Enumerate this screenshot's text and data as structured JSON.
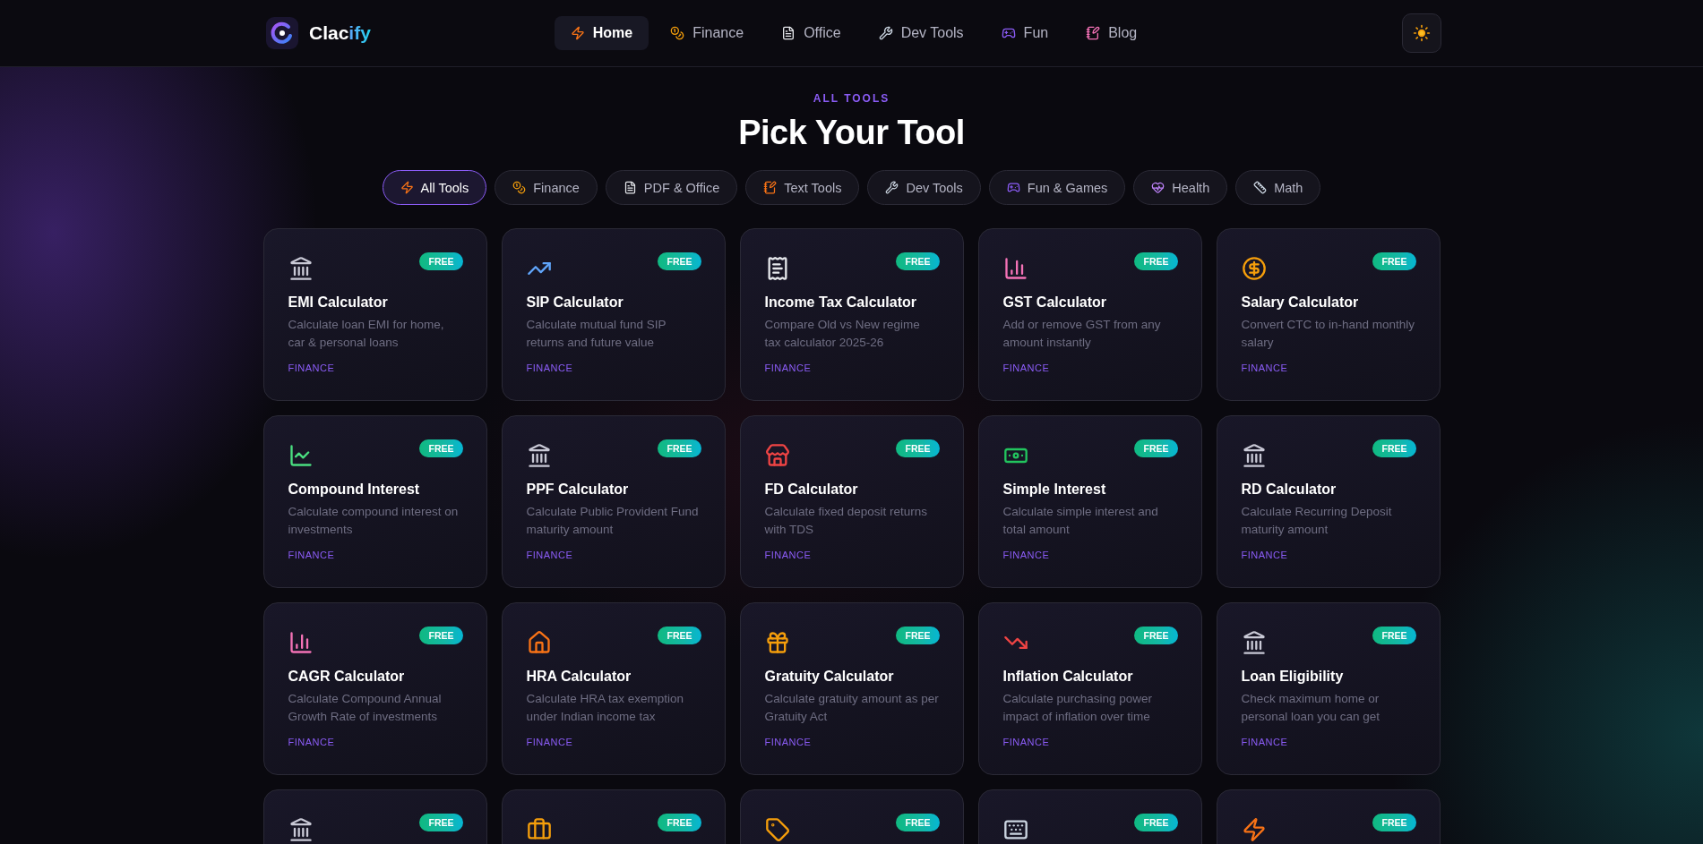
{
  "header": {
    "logo": {
      "text": "Clac",
      "accent": "ify"
    },
    "nav": [
      {
        "label": "Home",
        "selected": true
      },
      {
        "label": "Finance",
        "selected": false
      },
      {
        "label": "Office",
        "selected": false
      },
      {
        "label": "Dev Tools",
        "selected": false
      },
      {
        "label": "Fun",
        "selected": false
      },
      {
        "label": "Blog",
        "selected": false
      }
    ]
  },
  "hero": {
    "eyebrow": "ALL TOOLS",
    "title": "Pick Your Tool"
  },
  "filters": [
    {
      "label": "All Tools",
      "selected": true
    },
    {
      "label": "Finance",
      "selected": false
    },
    {
      "label": "PDF & Office",
      "selected": false
    },
    {
      "label": "Text Tools",
      "selected": false
    },
    {
      "label": "Dev Tools",
      "selected": false
    },
    {
      "label": "Fun & Games",
      "selected": false
    },
    {
      "label": "Health",
      "selected": false
    },
    {
      "label": "Math",
      "selected": false
    }
  ],
  "tools": [
    {
      "badge": "FREE",
      "title": "EMI Calculator",
      "description": "Calculate loan EMI for home, car & personal loans",
      "category": "FINANCE"
    },
    {
      "badge": "FREE",
      "title": "SIP Calculator",
      "description": "Calculate mutual fund SIP returns and future value",
      "category": "FINANCE"
    },
    {
      "badge": "FREE",
      "title": "Income Tax Calculator",
      "description": "Compare Old vs New regime tax calculator 2025-26",
      "category": "FINANCE"
    },
    {
      "badge": "FREE",
      "title": "GST Calculator",
      "description": "Add or remove GST from any amount instantly",
      "category": "FINANCE"
    },
    {
      "badge": "FREE",
      "title": "Salary Calculator",
      "description": "Convert CTC to in-hand monthly salary",
      "category": "FINANCE"
    },
    {
      "badge": "FREE",
      "title": "Compound Interest",
      "description": "Calculate compound interest on investments",
      "category": "FINANCE"
    },
    {
      "badge": "FREE",
      "title": "PPF Calculator",
      "description": "Calculate Public Provident Fund maturity amount",
      "category": "FINANCE"
    },
    {
      "badge": "FREE",
      "title": "FD Calculator",
      "description": "Calculate fixed deposit returns with TDS",
      "category": "FINANCE"
    },
    {
      "badge": "FREE",
      "title": "Simple Interest",
      "description": "Calculate simple interest and total amount",
      "category": "FINANCE"
    },
    {
      "badge": "FREE",
      "title": "RD Calculator",
      "description": "Calculate Recurring Deposit maturity amount",
      "category": "FINANCE"
    },
    {
      "badge": "FREE",
      "title": "CAGR Calculator",
      "description": "Calculate Compound Annual Growth Rate of investments",
      "category": "FINANCE"
    },
    {
      "badge": "FREE",
      "title": "HRA Calculator",
      "description": "Calculate HRA tax exemption under Indian income tax",
      "category": "FINANCE"
    },
    {
      "badge": "FREE",
      "title": "Gratuity Calculator",
      "description": "Calculate gratuity amount as per Gratuity Act",
      "category": "FINANCE"
    },
    {
      "badge": "FREE",
      "title": "Inflation Calculator",
      "description": "Calculate purchasing power impact of inflation over time",
      "category": "FINANCE"
    },
    {
      "badge": "FREE",
      "title": "Loan Eligibility",
      "description": "Check maximum home or personal loan you can get",
      "category": "FINANCE"
    },
    {
      "badge": "FREE"
    },
    {
      "badge": "FREE"
    },
    {
      "badge": "FREE"
    },
    {
      "badge": "FREE"
    },
    {
      "badge": "FREE"
    }
  ]
}
